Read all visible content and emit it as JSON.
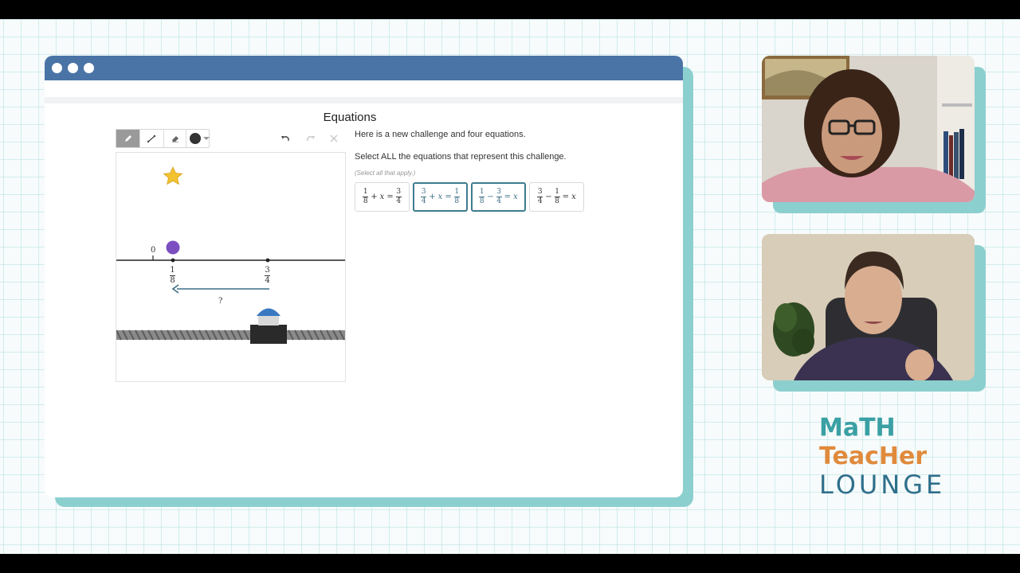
{
  "window": {
    "title": "Equations"
  },
  "toolbar": {
    "tools": [
      "pencil-icon",
      "line-icon",
      "eraser-icon"
    ],
    "color": "#333333",
    "actions": [
      "undo-icon",
      "redo-icon",
      "clear-icon"
    ]
  },
  "canvas": {
    "number_line": {
      "zero_label": "0",
      "point1": {
        "num": "1",
        "den": "8"
      },
      "point2": {
        "num": "3",
        "den": "4"
      },
      "unknown_label": "?"
    }
  },
  "question": {
    "prompt": "Here is a new challenge and four equations.",
    "instruction": "Select ALL the equations that represent this challenge.",
    "hint": "(Select all that apply.)",
    "choices": [
      {
        "id": "a",
        "a_num": "1",
        "a_den": "8",
        "op": "+",
        "b": "x",
        "eq": "=",
        "c_num": "3",
        "c_den": "4",
        "selected": false
      },
      {
        "id": "b",
        "a_num": "3",
        "a_den": "4",
        "op": "+",
        "b": "x",
        "eq": "=",
        "c_num": "1",
        "c_den": "8",
        "selected": true
      },
      {
        "id": "c",
        "a_num": "1",
        "a_den": "8",
        "op": "−",
        "b_num": "3",
        "b_den": "4",
        "eq": "=",
        "c": "x",
        "selected": true
      },
      {
        "id": "d",
        "a_num": "3",
        "a_den": "4",
        "op": "−",
        "b_num": "1",
        "b_den": "8",
        "eq": "=",
        "c": "x",
        "selected": false
      }
    ]
  },
  "logo": {
    "line1": "MaTH",
    "line2": "TeacHer",
    "line3": "LOUNGE"
  },
  "colors": {
    "titlebar": "#4a74a6",
    "accent_teal": "#8ccfcf",
    "selected_border": "#3f7c8e",
    "star": "#f2c230",
    "purple_dot": "#7b4fc0",
    "cart_blue": "#3a78c2"
  }
}
